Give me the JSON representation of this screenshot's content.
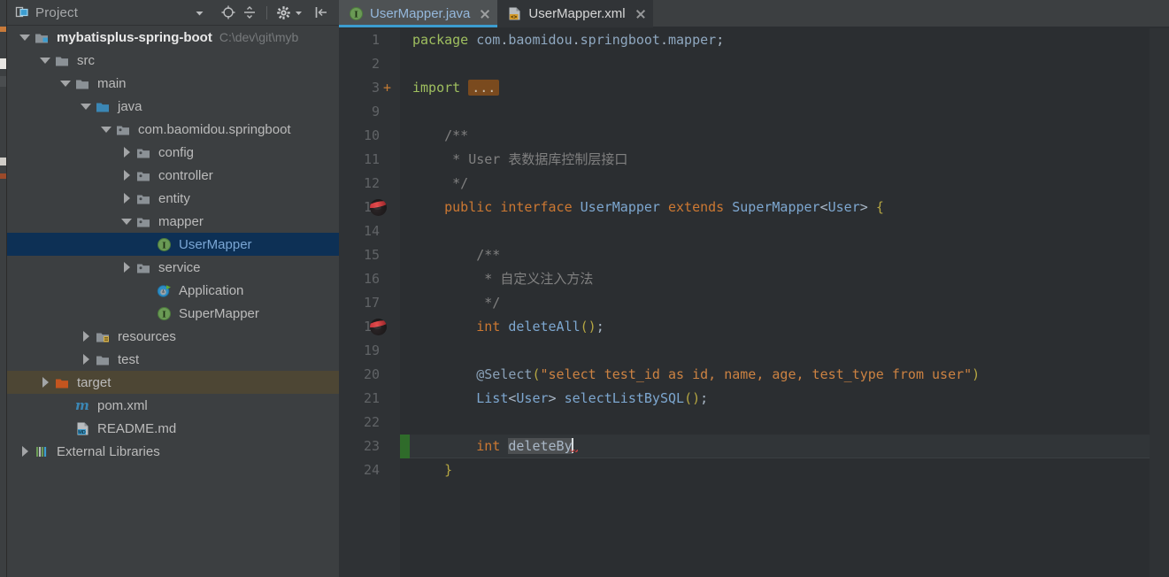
{
  "window": {
    "theme_bg": "#3c3f41",
    "editor_bg": "#2b2e31",
    "accent": "#3c9dd0"
  },
  "project_panel": {
    "title": "Project",
    "header_icons": [
      {
        "name": "project-view-icon",
        "glyph": "project"
      },
      {
        "name": "chevron-down-icon",
        "glyph": "caret-down"
      },
      {
        "name": "scroll-from-source-icon",
        "glyph": "target"
      },
      {
        "name": "collapse-all-icon",
        "glyph": "collapse"
      },
      {
        "name": "gear-icon",
        "glyph": "gear"
      },
      {
        "name": "hide-panel-icon",
        "glyph": "hide"
      }
    ],
    "tree": [
      {
        "label": "mybatisplus-spring-boot",
        "path": "C:\\dev\\git\\myb",
        "icon": "module-folder-icon",
        "indent": 0,
        "twisty": "down",
        "style": "bold-white",
        "state": "normal"
      },
      {
        "label": "src",
        "path": "",
        "icon": "folder-icon",
        "indent": 1,
        "twisty": "down",
        "style": "plain",
        "state": "normal"
      },
      {
        "label": "main",
        "path": "",
        "icon": "folder-icon",
        "indent": 2,
        "twisty": "down",
        "style": "plain",
        "state": "normal"
      },
      {
        "label": "java",
        "path": "",
        "icon": "source-root-folder-icon",
        "indent": 3,
        "twisty": "down",
        "style": "plain",
        "state": "normal"
      },
      {
        "label": "com.baomidou.springboot",
        "path": "",
        "icon": "package-icon",
        "indent": 4,
        "twisty": "down",
        "style": "plain",
        "state": "normal"
      },
      {
        "label": "config",
        "path": "",
        "icon": "package-icon",
        "indent": 5,
        "twisty": "right",
        "style": "plain",
        "state": "normal"
      },
      {
        "label": "controller",
        "path": "",
        "icon": "package-icon",
        "indent": 5,
        "twisty": "right",
        "style": "plain",
        "state": "normal"
      },
      {
        "label": "entity",
        "path": "",
        "icon": "package-icon",
        "indent": 5,
        "twisty": "right",
        "style": "plain",
        "state": "normal"
      },
      {
        "label": "mapper",
        "path": "",
        "icon": "package-icon",
        "indent": 5,
        "twisty": "down",
        "style": "plain",
        "state": "normal"
      },
      {
        "label": "UserMapper",
        "path": "",
        "icon": "interface-icon",
        "indent": 6,
        "twisty": "none",
        "style": "blue",
        "state": "selected"
      },
      {
        "label": "service",
        "path": "",
        "icon": "package-icon",
        "indent": 5,
        "twisty": "right",
        "style": "plain",
        "state": "normal"
      },
      {
        "label": "Application",
        "path": "",
        "icon": "spring-class-icon",
        "indent": 6,
        "twisty": "none",
        "style": "plain",
        "state": "normal"
      },
      {
        "label": "SuperMapper",
        "path": "",
        "icon": "interface-icon",
        "indent": 6,
        "twisty": "none",
        "style": "plain",
        "state": "normal"
      },
      {
        "label": "resources",
        "path": "",
        "icon": "resource-root-folder-icon",
        "indent": 3,
        "twisty": "right",
        "style": "plain",
        "state": "normal"
      },
      {
        "label": "test",
        "path": "",
        "icon": "folder-icon",
        "indent": 3,
        "twisty": "right",
        "style": "plain",
        "state": "normal"
      },
      {
        "label": "target",
        "path": "",
        "icon": "excluded-folder-icon",
        "indent": 1,
        "twisty": "right",
        "style": "plain",
        "state": "excluded-hover"
      },
      {
        "label": "pom.xml",
        "path": "",
        "icon": "maven-file-icon",
        "indent": 2,
        "twisty": "none",
        "style": "plain",
        "state": "normal"
      },
      {
        "label": "README.md",
        "path": "",
        "icon": "markdown-file-icon",
        "indent": 2,
        "twisty": "none",
        "style": "plain",
        "state": "normal"
      },
      {
        "label": "External Libraries",
        "path": "",
        "icon": "libraries-icon",
        "indent": 0,
        "twisty": "right",
        "style": "plain",
        "state": "normal"
      }
    ]
  },
  "editor": {
    "tabs": [
      {
        "label": "UserMapper.java",
        "icon": "interface-icon",
        "active": true,
        "closable": true
      },
      {
        "label": "UserMapper.xml",
        "icon": "xml-file-icon",
        "active": false,
        "closable": true
      }
    ],
    "lines": [
      {
        "num": "1",
        "gutter": "",
        "tokens": [
          {
            "t": "package ",
            "c": "kw2"
          },
          {
            "t": "com",
            "c": "pkg"
          },
          {
            "t": ".",
            "c": "punct"
          },
          {
            "t": "baomidou",
            "c": "pkg"
          },
          {
            "t": ".",
            "c": "punct"
          },
          {
            "t": "springboot",
            "c": "pkg"
          },
          {
            "t": ".",
            "c": "punct"
          },
          {
            "t": "mapper",
            "c": "pkg"
          },
          {
            "t": ";",
            "c": "punct"
          }
        ],
        "indent": 0
      },
      {
        "num": "2",
        "gutter": "",
        "tokens": [],
        "indent": 0
      },
      {
        "num": "3",
        "gutter": "fold-plus",
        "tokens": [
          {
            "t": "import ",
            "c": "kw2"
          },
          {
            "t": "...",
            "c": "fold-ellipsis"
          }
        ],
        "indent": 0
      },
      {
        "num": "9",
        "gutter": "",
        "tokens": [],
        "indent": 0
      },
      {
        "num": "10",
        "gutter": "",
        "tokens": [
          {
            "t": "/**",
            "c": "cmt"
          }
        ],
        "indent": 1
      },
      {
        "num": "11",
        "gutter": "",
        "tokens": [
          {
            "t": " * User 表数据库控制层接口",
            "c": "cmt"
          }
        ],
        "indent": 1
      },
      {
        "num": "12",
        "gutter": "",
        "tokens": [
          {
            "t": " */",
            "c": "cmt"
          }
        ],
        "indent": 1
      },
      {
        "num": "13",
        "gutter": "bean",
        "tokens": [
          {
            "t": "public ",
            "c": "kw"
          },
          {
            "t": "interface ",
            "c": "kw"
          },
          {
            "t": "UserMapper",
            "c": "cls"
          },
          {
            "t": " extends ",
            "c": "kw"
          },
          {
            "t": "SuperMapper",
            "c": "cls"
          },
          {
            "t": "<",
            "c": "punct"
          },
          {
            "t": "User",
            "c": "cls"
          },
          {
            "t": "> ",
            "c": "punct"
          },
          {
            "t": "{",
            "c": "brace"
          }
        ],
        "indent": 1
      },
      {
        "num": "14",
        "gutter": "",
        "tokens": [],
        "indent": 0
      },
      {
        "num": "15",
        "gutter": "",
        "tokens": [
          {
            "t": "/**",
            "c": "cmt"
          }
        ],
        "indent": 2
      },
      {
        "num": "16",
        "gutter": "",
        "tokens": [
          {
            "t": " * 自定义注入方法",
            "c": "cmt"
          }
        ],
        "indent": 2
      },
      {
        "num": "17",
        "gutter": "",
        "tokens": [
          {
            "t": " */",
            "c": "cmt"
          }
        ],
        "indent": 2
      },
      {
        "num": "18",
        "gutter": "bean",
        "tokens": [
          {
            "t": "int ",
            "c": "kw"
          },
          {
            "t": "deleteAll",
            "c": "mth"
          },
          {
            "t": "()",
            "c": "brace"
          },
          {
            "t": ";",
            "c": "punct"
          }
        ],
        "indent": 2
      },
      {
        "num": "19",
        "gutter": "",
        "tokens": [],
        "indent": 0
      },
      {
        "num": "20",
        "gutter": "",
        "tokens": [
          {
            "t": "@Select",
            "c": "annot"
          },
          {
            "t": "(",
            "c": "brace"
          },
          {
            "t": "\"select test_id as id, name, age, test_type from user\"",
            "c": "str"
          },
          {
            "t": ")",
            "c": "brace"
          }
        ],
        "indent": 2
      },
      {
        "num": "21",
        "gutter": "",
        "tokens": [
          {
            "t": "List",
            "c": "cls"
          },
          {
            "t": "<",
            "c": "punct"
          },
          {
            "t": "User",
            "c": "cls"
          },
          {
            "t": "> ",
            "c": "punct"
          },
          {
            "t": "selectListBySQL",
            "c": "mth"
          },
          {
            "t": "()",
            "c": "brace"
          },
          {
            "t": ";",
            "c": "punct"
          }
        ],
        "indent": 2
      },
      {
        "num": "22",
        "gutter": "",
        "tokens": [],
        "indent": 0
      },
      {
        "num": "23",
        "gutter": "changebar",
        "caret_line": true,
        "tokens": [
          {
            "t": "int ",
            "c": "kw"
          },
          {
            "t": "deleteBy",
            "c": "ident-hl"
          },
          {
            "t": "|caret|",
            "c": "caret"
          }
        ],
        "indent": 2
      },
      {
        "num": "24",
        "gutter": "",
        "tokens": [
          {
            "t": "}",
            "c": "brace"
          }
        ],
        "indent": 1
      }
    ]
  }
}
